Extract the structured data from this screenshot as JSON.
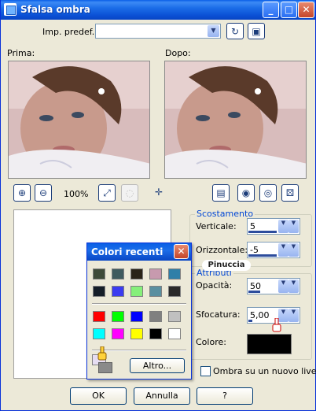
{
  "window": {
    "title": "Sfalsa ombra"
  },
  "presets": {
    "label": "Imp. predef.:",
    "value": ""
  },
  "preview": {
    "before_label": "Prima:",
    "after_label": "Dopo:",
    "zoom": "100%"
  },
  "offset": {
    "legend": "Scostamento",
    "vertical_label": "Verticale:",
    "vertical_value": "5",
    "horizontal_label": "Orizzontale:",
    "horizontal_value": "-5"
  },
  "attributes": {
    "legend": "Attributi",
    "opacity_label": "Opacità:",
    "opacity_value": "50",
    "blur_label": "Sfocatura:",
    "blur_value": "5,00",
    "color_label": "Colore:",
    "color_value": "#000000"
  },
  "checkbox": {
    "label": "Ombra su un nuovo livello",
    "checked": false
  },
  "buttons": {
    "ok": "OK",
    "cancel": "Annulla",
    "help": "?"
  },
  "recent_colors": {
    "title": "Colori recenti",
    "more_label": "Altro...",
    "row1": [
      "#3d4a3a",
      "#3f5a5e",
      "#2a2418",
      "#c79aae",
      "#2f7fa8"
    ],
    "row2": [
      "#151e28",
      "#3b3bf0",
      "#86f07a",
      "#5a8fa0",
      "#2a2a2a"
    ],
    "row3": [
      "#ff0000",
      "#00ff00",
      "#0000ff",
      "#808080",
      "#c0c0c0"
    ],
    "row4": [
      "#00ffff",
      "#ff00ff",
      "#ffff00",
      "#000000",
      "#ffffff"
    ]
  },
  "watermark": "Pinuccia"
}
